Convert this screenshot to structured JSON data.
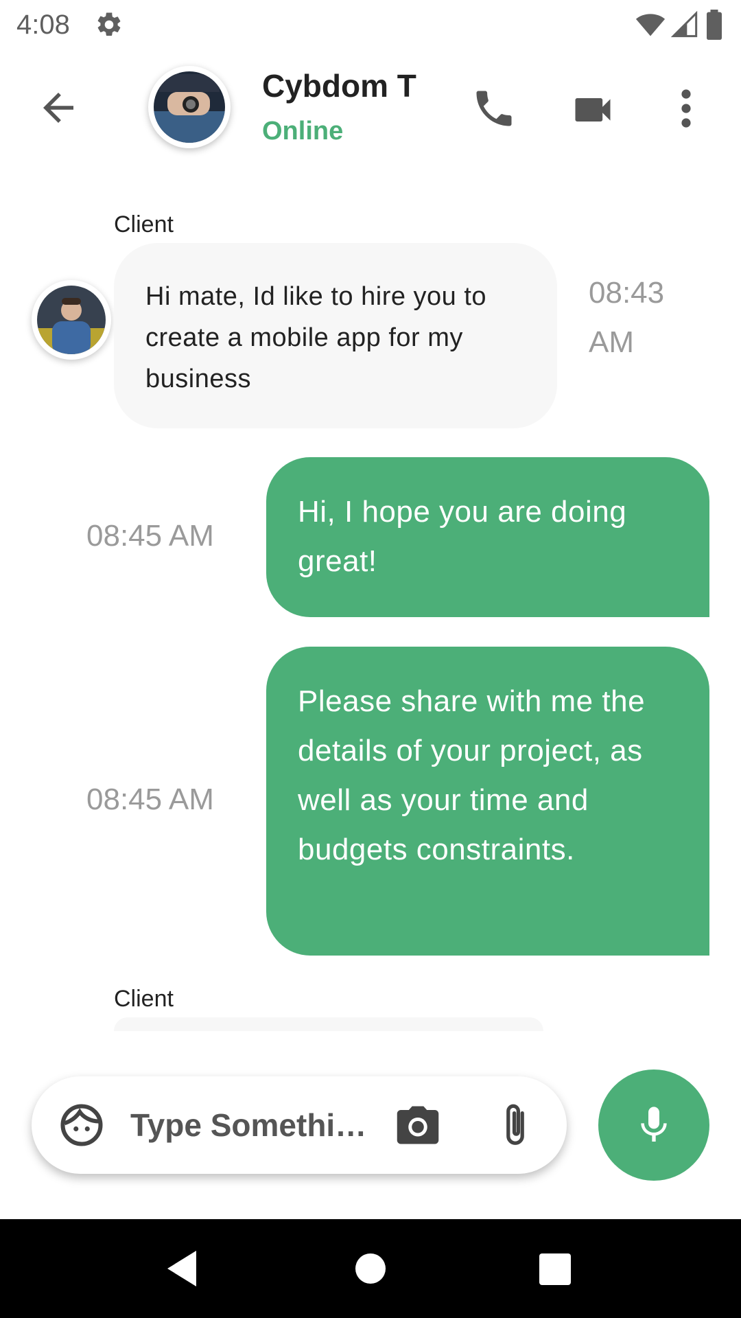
{
  "status_bar": {
    "time": "4:08",
    "icons": [
      "gear-icon",
      "wifi-icon",
      "signal-icon",
      "battery-icon"
    ]
  },
  "header": {
    "contact_name": "Cybdom T",
    "contact_status": "Online",
    "icons": [
      "arrow-back-icon",
      "phone-icon",
      "videocam-icon",
      "more-vert-icon"
    ]
  },
  "messages": [
    {
      "direction": "incoming",
      "sender": "Client",
      "text": "Hi mate, Id like to hire you to create a mobile app for my business",
      "time": "08:43 AM"
    },
    {
      "direction": "outgoing",
      "text": "Hi, I hope you are doing great!",
      "time": "08:45 AM"
    },
    {
      "direction": "outgoing",
      "text": "Please share with me the details of your project, as well as your time and budgets constraints.",
      "time": "08:45 AM"
    },
    {
      "direction": "incoming",
      "sender": "Client",
      "text": "",
      "time": ""
    }
  ],
  "composer": {
    "placeholder": "Type Somethi…",
    "icons": [
      "emoji-face-icon",
      "camera-icon",
      "attach-icon",
      "mic-icon"
    ]
  },
  "colors": {
    "accent": "#4caf78",
    "incoming_bubble": "#f7f7f7",
    "timestamp": "#9a9a9a"
  }
}
